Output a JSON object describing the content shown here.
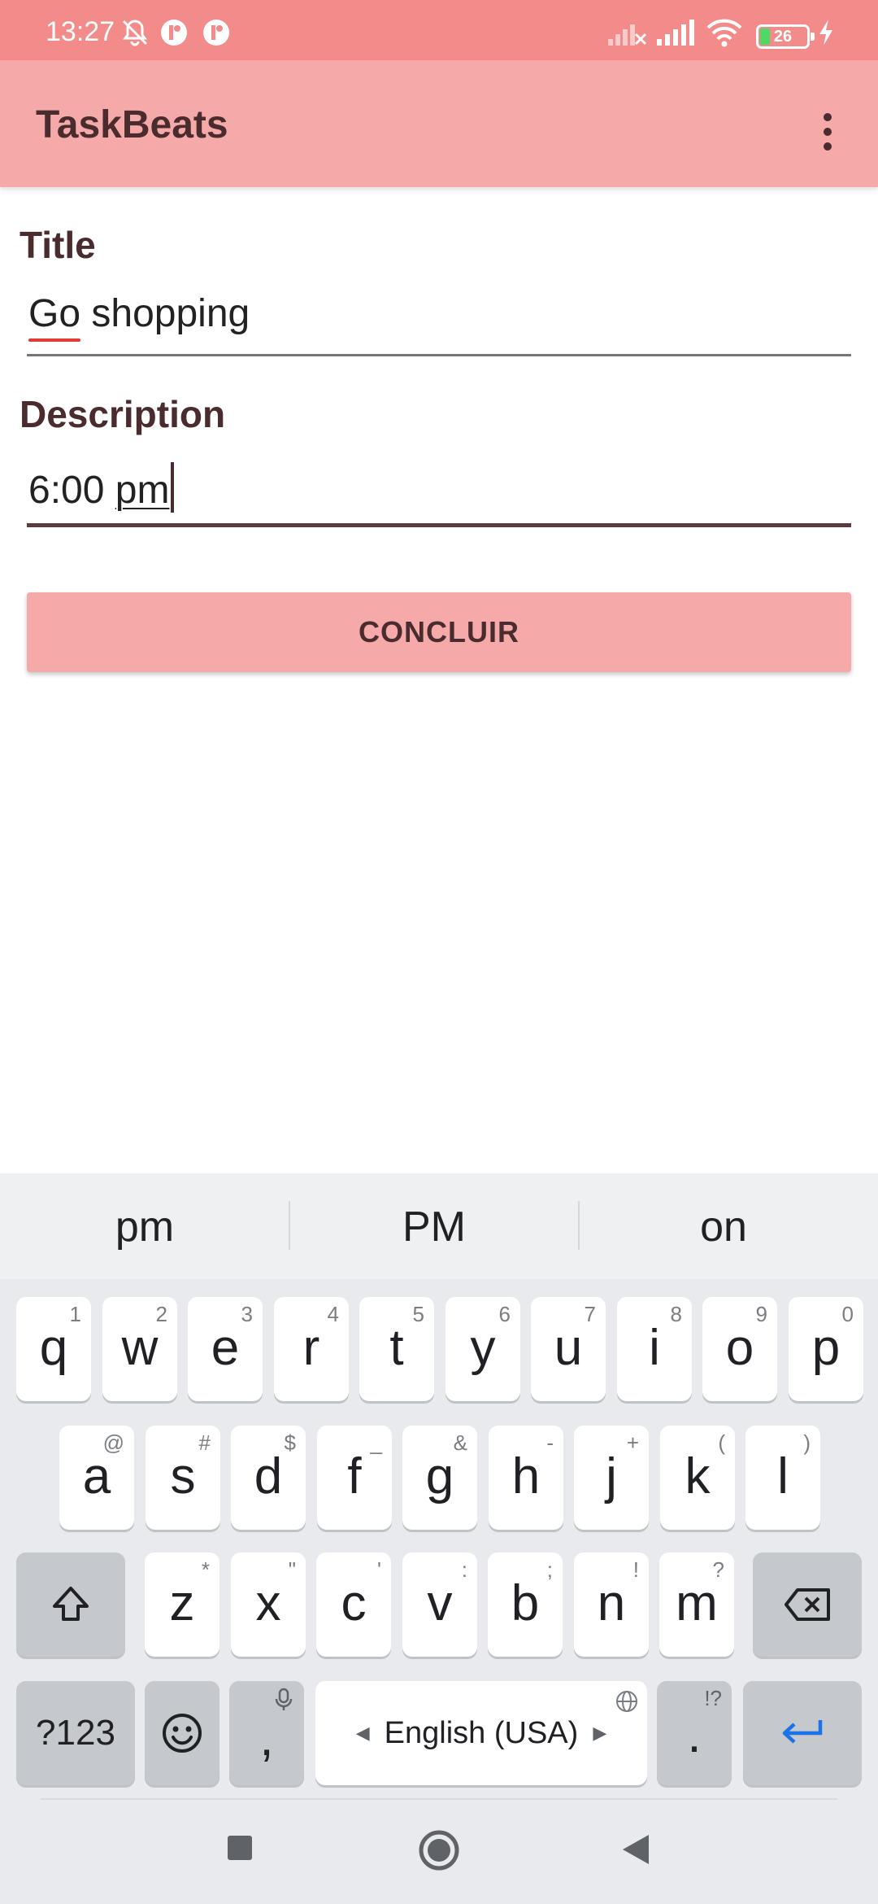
{
  "status_bar": {
    "time": "13:27",
    "battery": "26",
    "icons": [
      "bell-off-icon",
      "notification-app-icon",
      "notification-app-icon",
      "signal-off-icon",
      "signal-icon",
      "wifi-icon",
      "battery-icon",
      "charging-icon"
    ]
  },
  "app_bar": {
    "title": "TaskBeats",
    "menu_icon": "more-vert-icon"
  },
  "form": {
    "title_label": "Title",
    "title_value_word1": "Go",
    "title_value_rest": " shopping",
    "description_label": "Description",
    "description_value_time": "6:00 ",
    "description_value_composing": "pm",
    "submit_label": "CONCLUIR"
  },
  "keyboard": {
    "suggestions": [
      "pm",
      "PM",
      "on"
    ],
    "row1": [
      {
        "k": "q",
        "h": "1"
      },
      {
        "k": "w",
        "h": "2"
      },
      {
        "k": "e",
        "h": "3"
      },
      {
        "k": "r",
        "h": "4"
      },
      {
        "k": "t",
        "h": "5"
      },
      {
        "k": "y",
        "h": "6"
      },
      {
        "k": "u",
        "h": "7"
      },
      {
        "k": "i",
        "h": "8"
      },
      {
        "k": "o",
        "h": "9"
      },
      {
        "k": "p",
        "h": "0"
      }
    ],
    "row2": [
      {
        "k": "a",
        "h": "@"
      },
      {
        "k": "s",
        "h": "#"
      },
      {
        "k": "d",
        "h": "$"
      },
      {
        "k": "f",
        "h": "_"
      },
      {
        "k": "g",
        "h": "&"
      },
      {
        "k": "h",
        "h": "-"
      },
      {
        "k": "j",
        "h": "+"
      },
      {
        "k": "k",
        "h": "("
      },
      {
        "k": "l",
        "h": ")"
      }
    ],
    "row3": [
      {
        "k": "z",
        "h": "*"
      },
      {
        "k": "x",
        "h": "\""
      },
      {
        "k": "c",
        "h": "'"
      },
      {
        "k": "v",
        "h": ":"
      },
      {
        "k": "b",
        "h": ";"
      },
      {
        "k": "n",
        "h": "!"
      },
      {
        "k": "m",
        "h": "?"
      }
    ],
    "symbols_label": "?123",
    "comma_label": ",",
    "space_label": "English (USA)",
    "period_label": ".",
    "period_hint": "!?",
    "colors": {
      "enter_arrow": "#1a73e8",
      "key": "#ffffff",
      "special_key": "#c5c8cc"
    }
  },
  "colors": {
    "status_bar": "#f28b89",
    "app_bar": "#f5a9a8",
    "primary_text": "#4a2b2e",
    "spell_underline": "#e53935"
  }
}
